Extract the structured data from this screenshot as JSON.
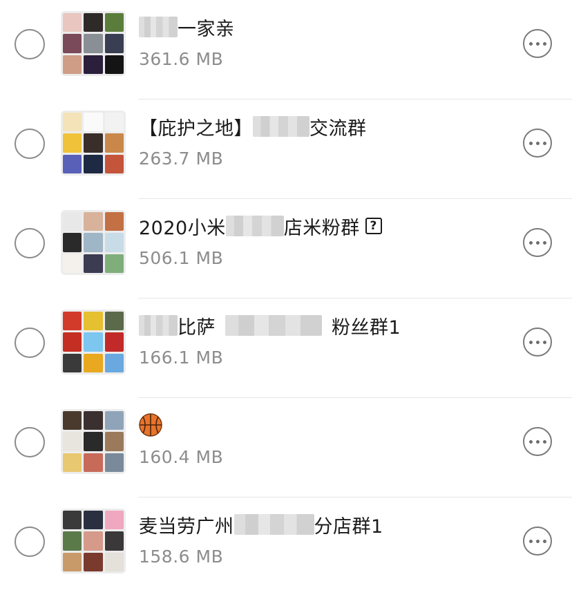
{
  "groups": [
    {
      "title_parts": [
        {
          "blur": 56
        },
        {
          "text": "一家亲"
        }
      ],
      "size": "361.6 MB",
      "avatar_colors": [
        "#e9c6c0",
        "#2e2a28",
        "#5b7d3c",
        "#7a4a5a",
        "#8a8f96",
        "#3a3e52",
        "#cf9c86",
        "#2b1f3c",
        "#141414"
      ]
    },
    {
      "title_parts": [
        {
          "text": "【庇护之地】"
        },
        {
          "blur": 82
        },
        {
          "text": "交流群"
        }
      ],
      "size": "263.7 MB",
      "avatar_colors": [
        "#f4e3b8",
        "#fafafa",
        "#f2f2f2",
        "#f0c23a",
        "#3a2e2a",
        "#c9884a",
        "#5860b8",
        "#1e2a44",
        "#c4543a"
      ]
    },
    {
      "title_parts": [
        {
          "text": "2020小米"
        },
        {
          "blur": 84
        },
        {
          "text": "店米粉群"
        },
        {
          "qbox": "?"
        }
      ],
      "size": "506.1 MB",
      "avatar_colors": [
        "#e8e8e8",
        "#d8b29a",
        "#c27044",
        "#2a2a2a",
        "#9fb6c6",
        "#c8dce8",
        "#f4f0ec",
        "#3b3b52",
        "#7fae7a"
      ]
    },
    {
      "title_parts": [
        {
          "blur": 56
        },
        {
          "text": "比萨"
        },
        {
          "blur": 140,
          "gap": true
        },
        {
          "text": "粉丝群1"
        }
      ],
      "size": "166.1 MB",
      "avatar_colors": [
        "#d23a2a",
        "#e5c030",
        "#5a6a4a",
        "#c52e22",
        "#7cc6f0",
        "#c22a2a",
        "#3a3a3a",
        "#e8a820",
        "#6aa8e0"
      ]
    },
    {
      "title_parts": [
        {
          "emoji": "basketball"
        }
      ],
      "size": "160.4 MB",
      "avatar_colors": [
        "#4a3a2e",
        "#3a3030",
        "#8fa4b8",
        "#e8e4de",
        "#2a2a2a",
        "#9a7a5a",
        "#e8c870",
        "#c86a5a",
        "#7a8a9a"
      ]
    },
    {
      "title_parts": [
        {
          "text": "麦当劳广州"
        },
        {
          "blur": 116
        },
        {
          "text": "分店群1"
        }
      ],
      "size": "158.6 MB",
      "avatar_colors": [
        "#3a3a3a",
        "#2a3040",
        "#f0a8c0",
        "#5a7a4a",
        "#d69a8a",
        "#3a3838",
        "#c89a6a",
        "#7a3a2e",
        "#e4e0da"
      ]
    }
  ],
  "colors": {
    "divider": "#e6e6e6",
    "secondary_text": "#8c8c8c",
    "control_border": "#8a8a8a"
  },
  "icons": {
    "select": "circle-radio-icon",
    "more": "more-horizontal-icon",
    "emoji": "basketball-emoji-icon"
  }
}
